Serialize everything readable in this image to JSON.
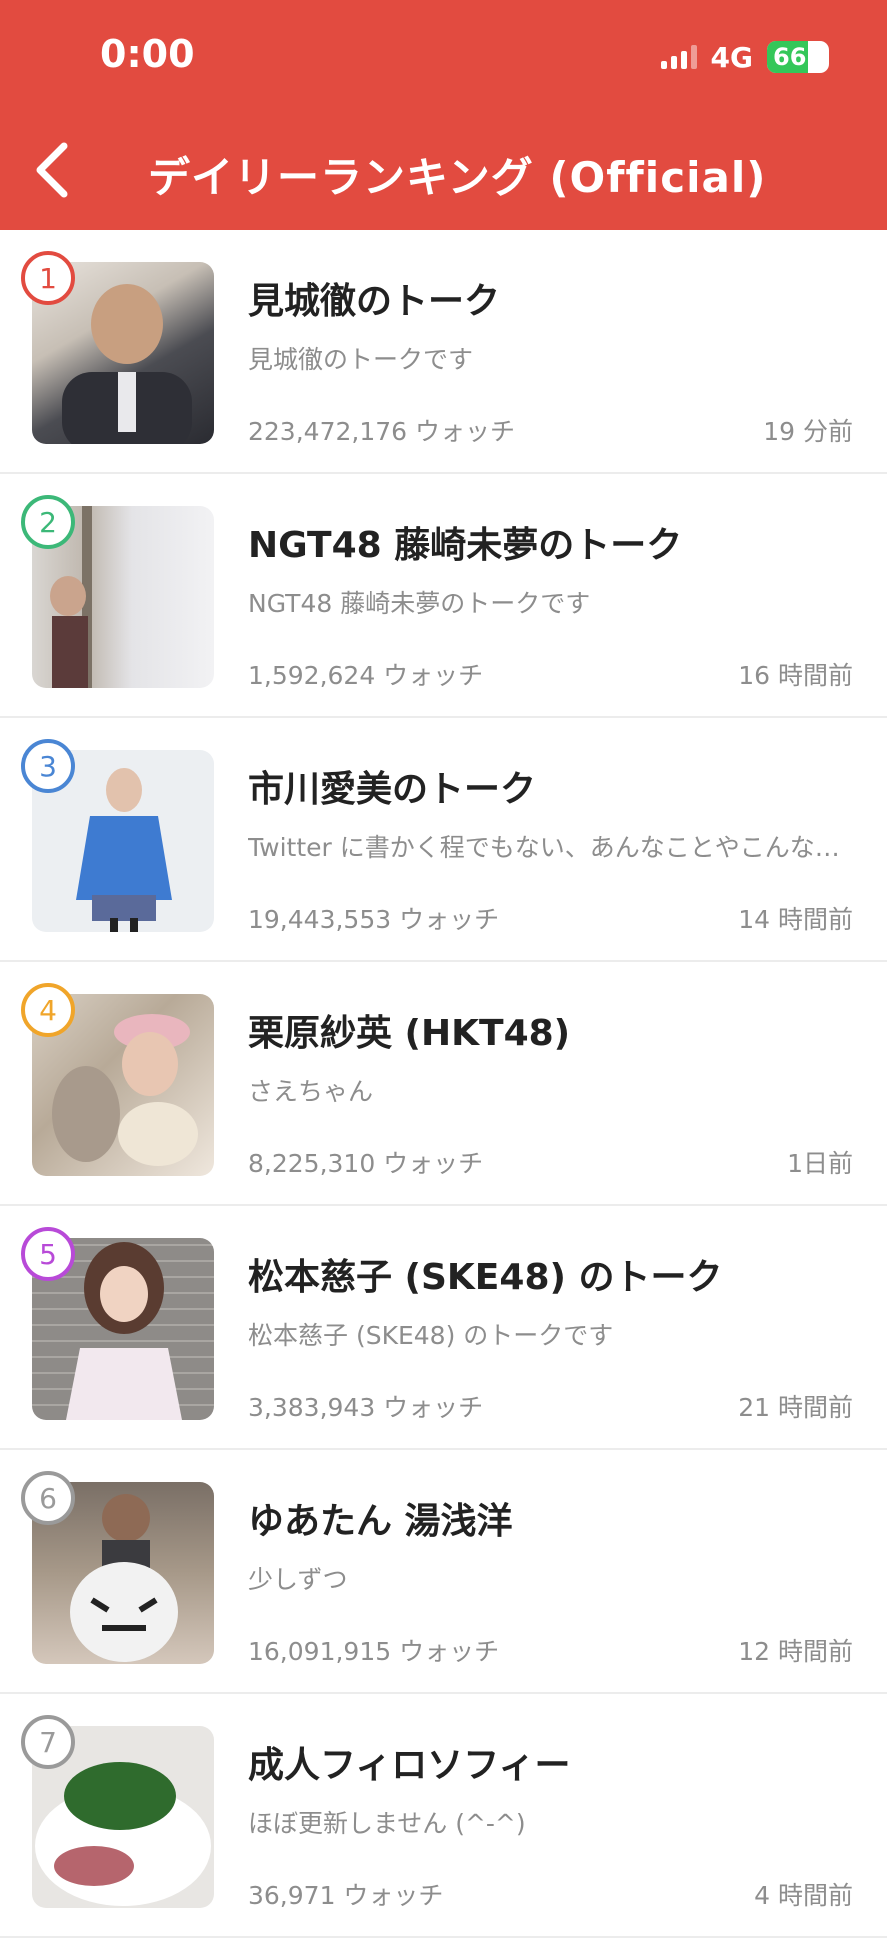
{
  "status_bar": {
    "time": "0:00",
    "network": "4G",
    "battery_percent": 66,
    "battery_label": "66"
  },
  "nav": {
    "back_icon": "chevron-left-icon",
    "title": "デイリーランキング (Official)"
  },
  "colors": {
    "header": "#e24b40",
    "text_secondary": "#8d8d8d"
  },
  "items": [
    {
      "rank": "1",
      "rank_color": "#e24b40",
      "title": "見城徹のトーク",
      "description": "見城徹のトークです",
      "watch": "223,472,176 ウォッチ",
      "time": "19 分前"
    },
    {
      "rank": "2",
      "rank_color": "#3cb878",
      "title": "NGT48 藤崎未夢のトーク",
      "description": "NGT48 藤崎未夢のトークです",
      "watch": "1,592,624 ウォッチ",
      "time": "16 時間前"
    },
    {
      "rank": "3",
      "rank_color": "#4a86d4",
      "title": "市川愛美のトーク",
      "description": "Twitter に書かく程でもない、あんなことやこんなことを…",
      "watch": "19,443,553 ウォッチ",
      "time": "14 時間前"
    },
    {
      "rank": "4",
      "rank_color": "#f0a52a",
      "title": "栗原紗英 (HKT48)",
      "description": "さえちゃん",
      "watch": "8,225,310 ウォッチ",
      "time": "1日前"
    },
    {
      "rank": "5",
      "rank_color": "#b84ad8",
      "title": "松本慈子 (SKE48) のトーク",
      "description": "松本慈子 (SKE48) のトークです",
      "watch": "3,383,943 ウォッチ",
      "time": "21 時間前"
    },
    {
      "rank": "6",
      "rank_color": "#9a9a9a",
      "title": "ゆあたん 湯浅洋",
      "description": "少しずつ",
      "watch": "16,091,915 ウォッチ",
      "time": "12 時間前"
    },
    {
      "rank": "7",
      "rank_color": "#9a9a9a",
      "title": "成人フィロソフィー",
      "description": "ほぼ更新しません (^-^)",
      "watch": "36,971 ウォッチ",
      "time": "4 時間前"
    }
  ]
}
